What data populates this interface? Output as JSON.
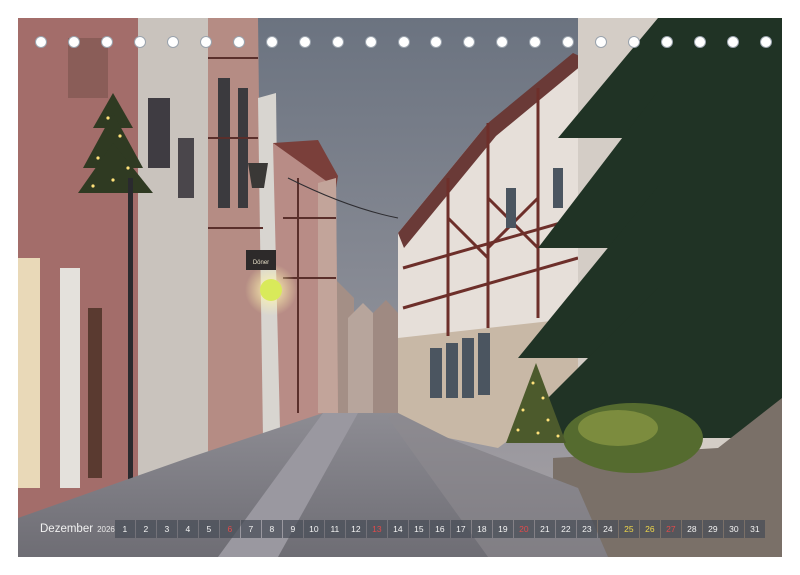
{
  "calendar": {
    "month": "Dezember",
    "year": "2026",
    "days": [
      {
        "n": "1"
      },
      {
        "n": "2"
      },
      {
        "n": "3"
      },
      {
        "n": "4"
      },
      {
        "n": "5"
      },
      {
        "n": "6",
        "sunday": true
      },
      {
        "n": "7"
      },
      {
        "n": "8"
      },
      {
        "n": "9"
      },
      {
        "n": "10"
      },
      {
        "n": "11"
      },
      {
        "n": "12"
      },
      {
        "n": "13",
        "sunday": true
      },
      {
        "n": "14"
      },
      {
        "n": "15"
      },
      {
        "n": "16"
      },
      {
        "n": "17"
      },
      {
        "n": "18"
      },
      {
        "n": "19"
      },
      {
        "n": "20",
        "sunday": true
      },
      {
        "n": "21"
      },
      {
        "n": "22"
      },
      {
        "n": "23"
      },
      {
        "n": "24"
      },
      {
        "n": "25",
        "holiday": true
      },
      {
        "n": "26",
        "holiday": true
      },
      {
        "n": "27",
        "sunday": true
      },
      {
        "n": "28"
      },
      {
        "n": "29"
      },
      {
        "n": "30"
      },
      {
        "n": "31"
      }
    ],
    "hole_count": 23,
    "colors": {
      "sunday": "#e24a4a",
      "holiday": "#f0d84a",
      "strip": "#464c56"
    }
  },
  "photo": {
    "subject": "cobblestone street with half-timbered houses and Christmas trees at dusk",
    "signs": [
      "Döner"
    ]
  }
}
